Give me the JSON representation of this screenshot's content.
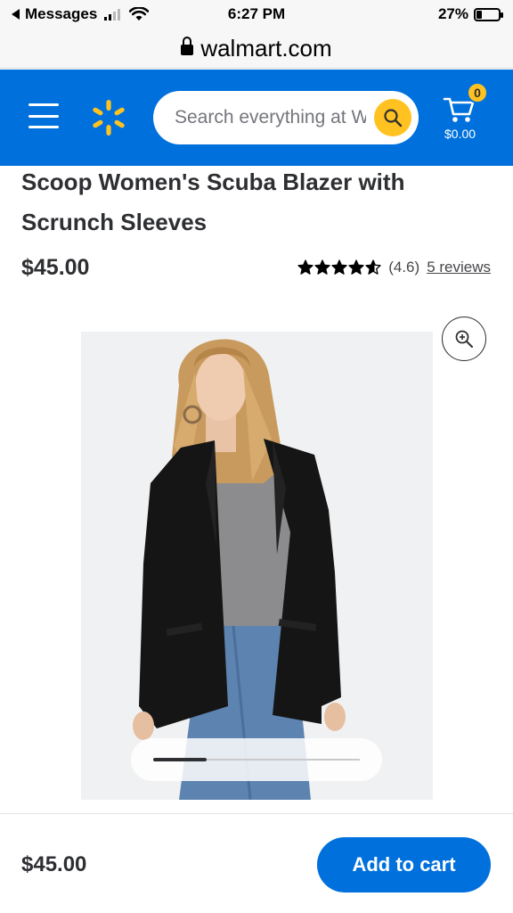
{
  "status_bar": {
    "back_label": "Messages",
    "time": "6:27 PM",
    "battery_percent": "27%",
    "battery_level": 0.27
  },
  "url_bar": {
    "domain": "walmart.com"
  },
  "header": {
    "search_placeholder": "Search everything at Walmart",
    "cart_count": "0",
    "cart_total": "$0.00",
    "brand_color": "#0071dc",
    "accent_color": "#ffc220"
  },
  "product": {
    "title": "Scoop Women's Scuba Blazer with Scrunch Sleeves",
    "price": "$45.00",
    "rating_value": 4.6,
    "rating_text": "(4.6)",
    "reviews_link": "5 reviews"
  },
  "gallery": {
    "progress": 0.26
  },
  "bottom_bar": {
    "price": "$45.00",
    "add_to_cart_label": "Add to cart"
  },
  "icons": [
    "back-arrow-icon",
    "wifi-icon",
    "battery-icon",
    "lock-icon",
    "menu-icon",
    "walmart-spark-icon",
    "search-icon",
    "cart-icon",
    "star-icon",
    "zoom-in-icon"
  ]
}
